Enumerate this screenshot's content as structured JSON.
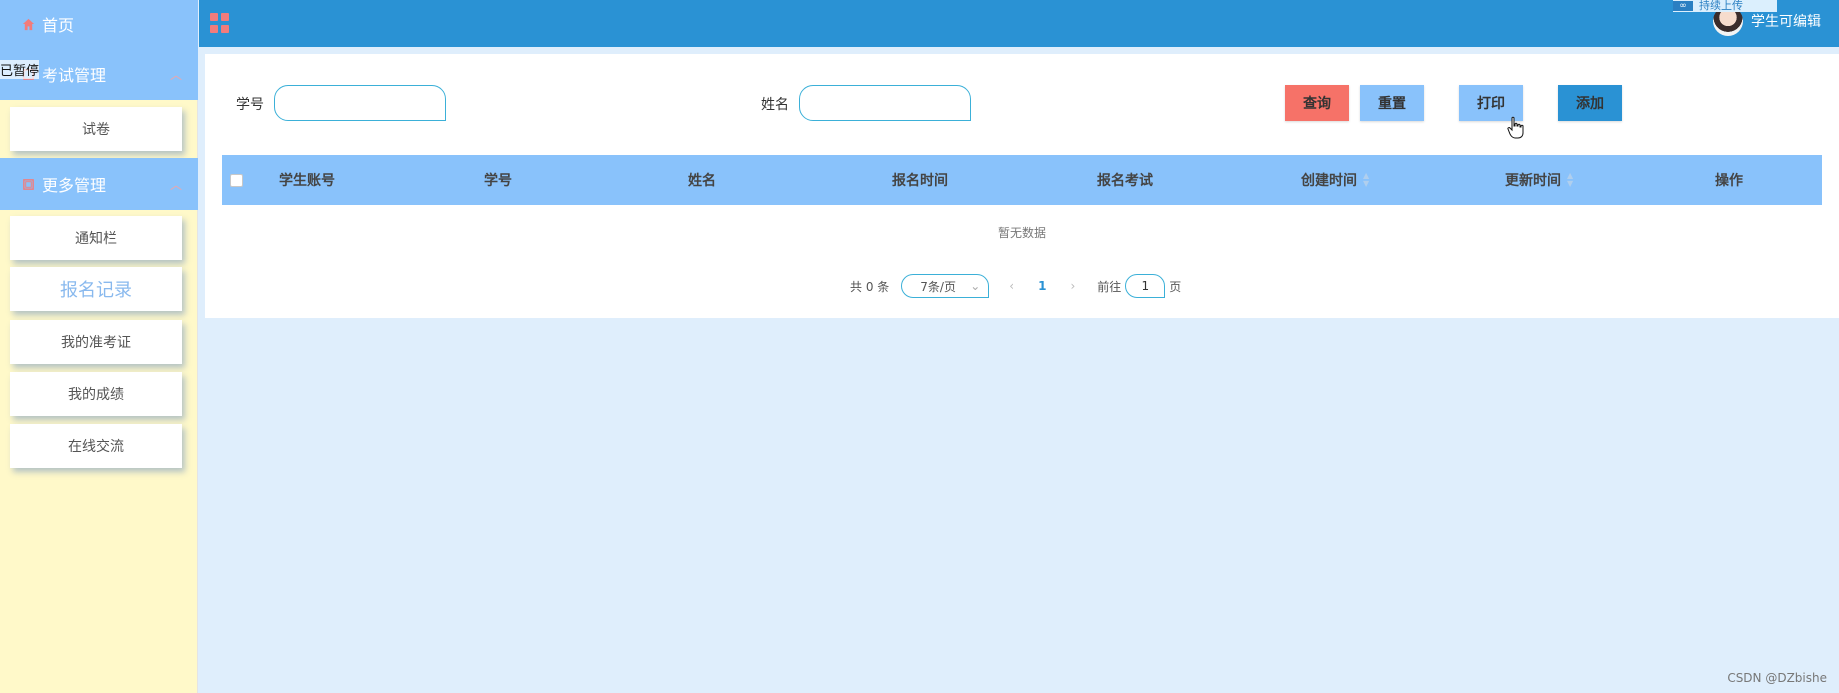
{
  "sidebar": {
    "home_label": "首页",
    "exam_group_label": "考试管理",
    "exam_items": [
      {
        "label": "试卷"
      }
    ],
    "more_group_label": "更多管理",
    "more_items": [
      {
        "label": "通知栏"
      },
      {
        "label": "报名记录"
      },
      {
        "label": "我的准考证"
      },
      {
        "label": "我的成绩"
      },
      {
        "label": "在线交流"
      }
    ],
    "overlay_text": "已暂停"
  },
  "header": {
    "username": "学生可编辑",
    "upload_badge": "持续上传"
  },
  "search": {
    "student_no_label": "学号",
    "student_no_value": "",
    "name_label": "姓名",
    "name_value": ""
  },
  "toolbar": {
    "query_label": "查询",
    "reset_label": "重置",
    "print_label": "打印",
    "add_label": "添加"
  },
  "table": {
    "columns": [
      "学生账号",
      "学号",
      "姓名",
      "报名时间",
      "报名考试",
      "创建时间",
      "更新时间",
      "操作"
    ],
    "empty_text": "暂无数据"
  },
  "pagination": {
    "total_text": "共 0 条",
    "page_size": "7条/页",
    "current_page": "1",
    "goto_label": "前往",
    "goto_value": "1",
    "page_suffix": "页"
  },
  "watermark": "CSDN @DZbishe",
  "colors": {
    "sidebar_bg": "#fff9c9",
    "sidebar_head": "#89c2fb",
    "topbar": "#2a92d4",
    "query_btn": "#f67268",
    "add_btn": "#2a92d4",
    "page_bg": "#dfeefc"
  }
}
